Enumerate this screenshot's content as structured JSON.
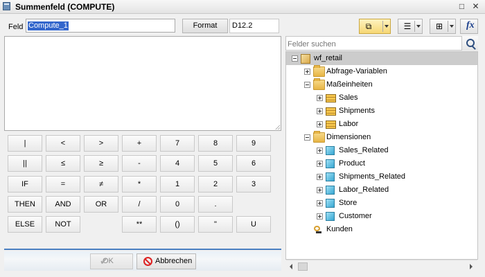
{
  "window": {
    "title": "Summenfeld (COMPUTE)",
    "icon": "calculator-icon"
  },
  "field": {
    "label": "Feld",
    "value": "Compute_1"
  },
  "format": {
    "button_label": "Format",
    "value": "D12.2"
  },
  "keypad": {
    "rows": [
      [
        "|",
        "<",
        ">",
        "+",
        "7",
        "8",
        "9"
      ],
      [
        "||",
        "≤",
        "≥",
        "-",
        "4",
        "5",
        "6"
      ],
      [
        "IF",
        "=",
        "≠",
        "*",
        "1",
        "2",
        "3"
      ],
      [
        "THEN",
        "AND",
        "OR",
        "/",
        "0",
        ".",
        ""
      ],
      [
        "ELSE",
        "NOT",
        "",
        "**",
        "()",
        "\"",
        "U"
      ]
    ]
  },
  "buttons": {
    "ok": "OK",
    "cancel": "Abbrechen"
  },
  "toolbar": {
    "icons": [
      "field-view-icon",
      "list-view-icon",
      "tree-view-icon",
      "function-icon"
    ],
    "fx_label": "fx"
  },
  "search": {
    "placeholder": "Felder suchen"
  },
  "tree": [
    {
      "label": "wf_retail",
      "icon": "database-cube-icon",
      "expanded": true,
      "selected": true
    },
    {
      "label": "Abfrage-Variablen",
      "icon": "folder-icon",
      "expanded": false
    },
    {
      "label": "Maßeinheiten",
      "icon": "folder-open-icon",
      "expanded": true
    },
    {
      "label": "Sales",
      "icon": "measure-group-icon",
      "expanded": false
    },
    {
      "label": "Shipments",
      "icon": "measure-group-icon",
      "expanded": false
    },
    {
      "label": "Labor",
      "icon": "measure-group-icon",
      "expanded": false
    },
    {
      "label": "Dimensionen",
      "icon": "folder-open-icon",
      "expanded": true
    },
    {
      "label": "Sales_Related",
      "icon": "dimension-cube-icon",
      "expanded": false
    },
    {
      "label": "Product",
      "icon": "dimension-cube-icon",
      "expanded": false
    },
    {
      "label": "Shipments_Related",
      "icon": "dimension-cube-icon",
      "expanded": false
    },
    {
      "label": "Labor_Related",
      "icon": "dimension-cube-icon",
      "expanded": false
    },
    {
      "label": "Store",
      "icon": "dimension-cube-icon",
      "expanded": false
    },
    {
      "label": "Customer",
      "icon": "dimension-cube-icon",
      "expanded": false
    },
    {
      "label": "Kunden",
      "icon": "filter-icon"
    }
  ],
  "colors": {
    "accent": "#4a7fc1",
    "selection": "#3366cc",
    "cancel_icon": "#dd2222"
  }
}
